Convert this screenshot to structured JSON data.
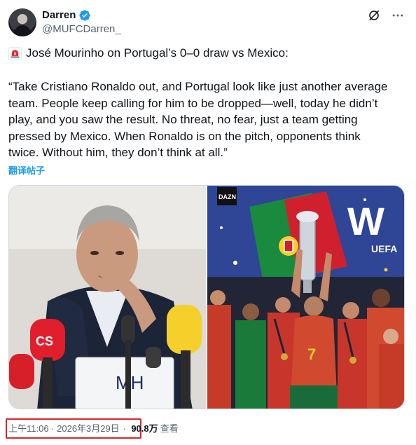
{
  "author": {
    "display_name": "Darren",
    "handle": "@MUFCDarren_",
    "avatar_icon": "profile-photo",
    "verified_icon": "verified-badge-icon",
    "verified_color": "#1d9bf0"
  },
  "post": {
    "headline": "José Mourinho on Portugal’s 0–0 draw vs Mexico:",
    "headline_icon": "rotating-light-emoji",
    "quote": "“Take Cristiano Ronaldo out, and Portugal look like just another average\nteam. People keep calling for him to be dropped—well, today he didn’t\nplay, and you saw the result. No threat, no fear, just a team getting\npressed by Mexico. When Ronaldo is on the pitch, opponents think\ntwice. Without him, they don’t think at all.”",
    "translate_label": "翻译帖子"
  },
  "media": {
    "left_image": {
      "icon": "mourinho-press-conference-photo",
      "backdrop_text": "MH",
      "mic_label": "CS"
    },
    "right_image": {
      "icon": "portugal-trophy-celebration-photo",
      "watermark": "DAZN",
      "banner_text": "UEFA",
      "banner_letters": "W",
      "shirt_number": "7"
    }
  },
  "meta": {
    "time": "上午11:06",
    "separator": " · ",
    "date": "2026年3月29日",
    "separator2": " · ",
    "views": "90.8万",
    "views_label": "查看",
    "highlight_color": "#e0242a"
  },
  "toolbar": {
    "grok_icon": "grok-icon",
    "more_icon": "more-options-icon"
  }
}
